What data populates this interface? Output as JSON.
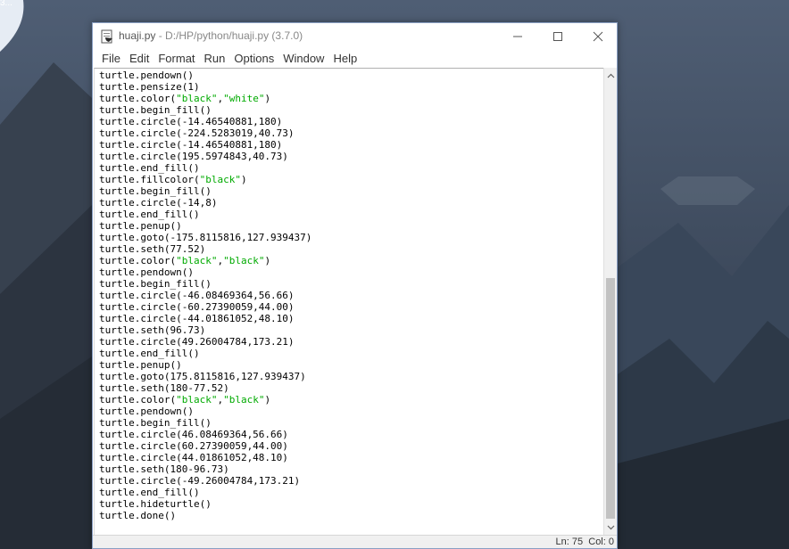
{
  "desktop": {
    "corner_label": "3..."
  },
  "window": {
    "title_name": "huaji.py",
    "title_path": " - D:/HP/python/huaji.py (3.7.0)"
  },
  "menu": [
    "File",
    "Edit",
    "Format",
    "Run",
    "Options",
    "Window",
    "Help"
  ],
  "code": [
    [
      {
        "t": "turtle.pendown()"
      }
    ],
    [
      {
        "t": "turtle.pensize(1)"
      }
    ],
    [
      {
        "t": "turtle.color("
      },
      {
        "t": "\"black\"",
        "s": true
      },
      {
        "t": ","
      },
      {
        "t": "\"white\"",
        "s": true
      },
      {
        "t": ")"
      }
    ],
    [
      {
        "t": "turtle.begin_fill()"
      }
    ],
    [
      {
        "t": "turtle.circle(-14.46540881,180)"
      }
    ],
    [
      {
        "t": "turtle.circle(-224.5283019,40.73)"
      }
    ],
    [
      {
        "t": "turtle.circle(-14.46540881,180)"
      }
    ],
    [
      {
        "t": "turtle.circle(195.5974843,40.73)"
      }
    ],
    [
      {
        "t": "turtle.end_fill()"
      }
    ],
    [
      {
        "t": "turtle.fillcolor("
      },
      {
        "t": "\"black\"",
        "s": true
      },
      {
        "t": ")"
      }
    ],
    [
      {
        "t": "turtle.begin_fill()"
      }
    ],
    [
      {
        "t": "turtle.circle(-14,8)"
      }
    ],
    [
      {
        "t": "turtle.end_fill()"
      }
    ],
    [
      {
        "t": "turtle.penup()"
      }
    ],
    [
      {
        "t": "turtle.goto(-175.8115816,127.939437)"
      }
    ],
    [
      {
        "t": "turtle.seth(77.52)"
      }
    ],
    [
      {
        "t": "turtle.color("
      },
      {
        "t": "\"black\"",
        "s": true
      },
      {
        "t": ","
      },
      {
        "t": "\"black\"",
        "s": true
      },
      {
        "t": ")"
      }
    ],
    [
      {
        "t": "turtle.pendown()"
      }
    ],
    [
      {
        "t": "turtle.begin_fill()"
      }
    ],
    [
      {
        "t": "turtle.circle(-46.08469364,56.66)"
      }
    ],
    [
      {
        "t": "turtle.circle(-60.27390059,44.00)"
      }
    ],
    [
      {
        "t": "turtle.circle(-44.01861052,48.10)"
      }
    ],
    [
      {
        "t": "turtle.seth(96.73)"
      }
    ],
    [
      {
        "t": "turtle.circle(49.26004784,173.21)"
      }
    ],
    [
      {
        "t": "turtle.end_fill()"
      }
    ],
    [
      {
        "t": "turtle.penup()"
      }
    ],
    [
      {
        "t": "turtle.goto(175.8115816,127.939437)"
      }
    ],
    [
      {
        "t": "turtle.seth(180-77.52)"
      }
    ],
    [
      {
        "t": "turtle.color("
      },
      {
        "t": "\"black\"",
        "s": true
      },
      {
        "t": ","
      },
      {
        "t": "\"black\"",
        "s": true
      },
      {
        "t": ")"
      }
    ],
    [
      {
        "t": "turtle.pendown()"
      }
    ],
    [
      {
        "t": "turtle.begin_fill()"
      }
    ],
    [
      {
        "t": "turtle.circle(46.08469364,56.66)"
      }
    ],
    [
      {
        "t": "turtle.circle(60.27390059,44.00)"
      }
    ],
    [
      {
        "t": "turtle.circle(44.01861052,48.10)"
      }
    ],
    [
      {
        "t": "turtle.seth(180-96.73)"
      }
    ],
    [
      {
        "t": "turtle.circle(-49.26004784,173.21)"
      }
    ],
    [
      {
        "t": "turtle.end_fill()"
      }
    ],
    [
      {
        "t": "turtle.hideturtle()"
      }
    ],
    [
      {
        "t": "turtle.done()"
      }
    ]
  ],
  "status": {
    "line": "Ln: 75",
    "col": "Col: 0"
  },
  "colors": {
    "string": "#00aa00",
    "scroll_thumb": "#c2c2c2"
  }
}
